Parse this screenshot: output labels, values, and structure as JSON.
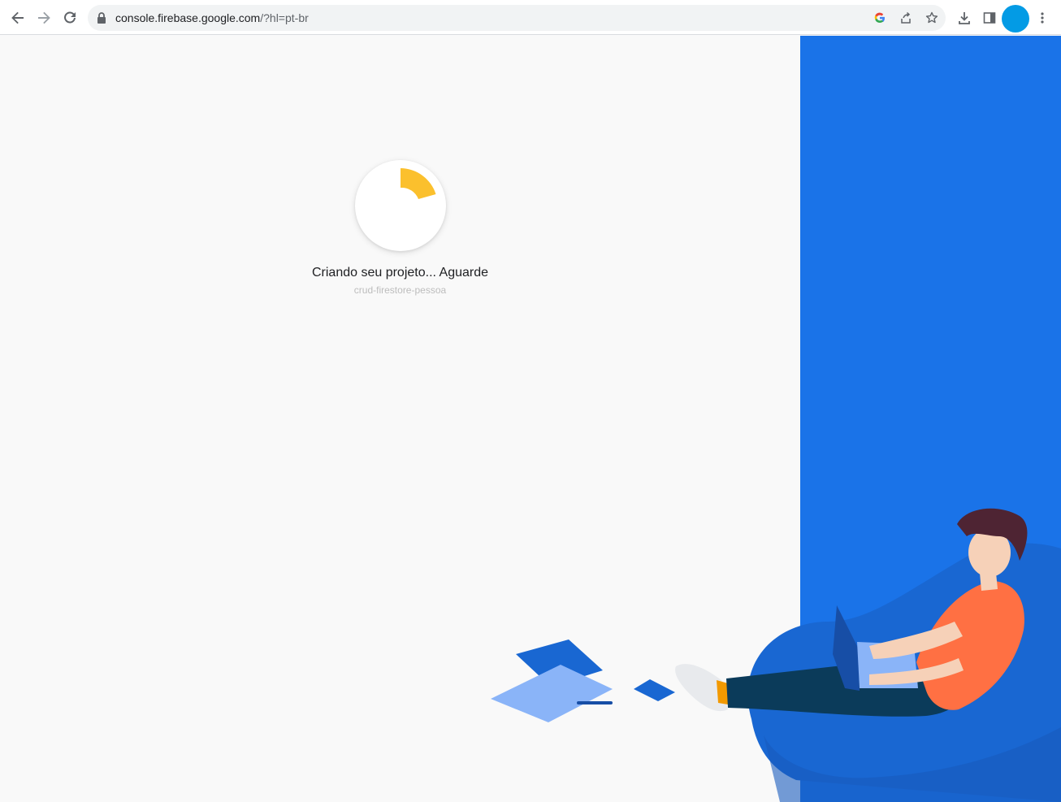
{
  "browser": {
    "url_host": "console.firebase.google.com",
    "url_path": "/?hl=pt-br",
    "icons": {
      "back": "arrow-left-icon",
      "forward": "arrow-right-icon",
      "reload": "reload-icon",
      "lock": "lock-icon",
      "google": "google-g-icon",
      "share": "share-icon",
      "bookmark": "star-icon",
      "download": "download-icon",
      "side_panel": "side-panel-icon",
      "menu": "kebab-menu-icon"
    },
    "avatar_color": "#039be5"
  },
  "page": {
    "status": "Criando seu projeto... Aguarde",
    "project_name": "crud-firestore-pessoa",
    "spinner_color": "#fbc02d",
    "panel_color": "#1a73e8"
  }
}
